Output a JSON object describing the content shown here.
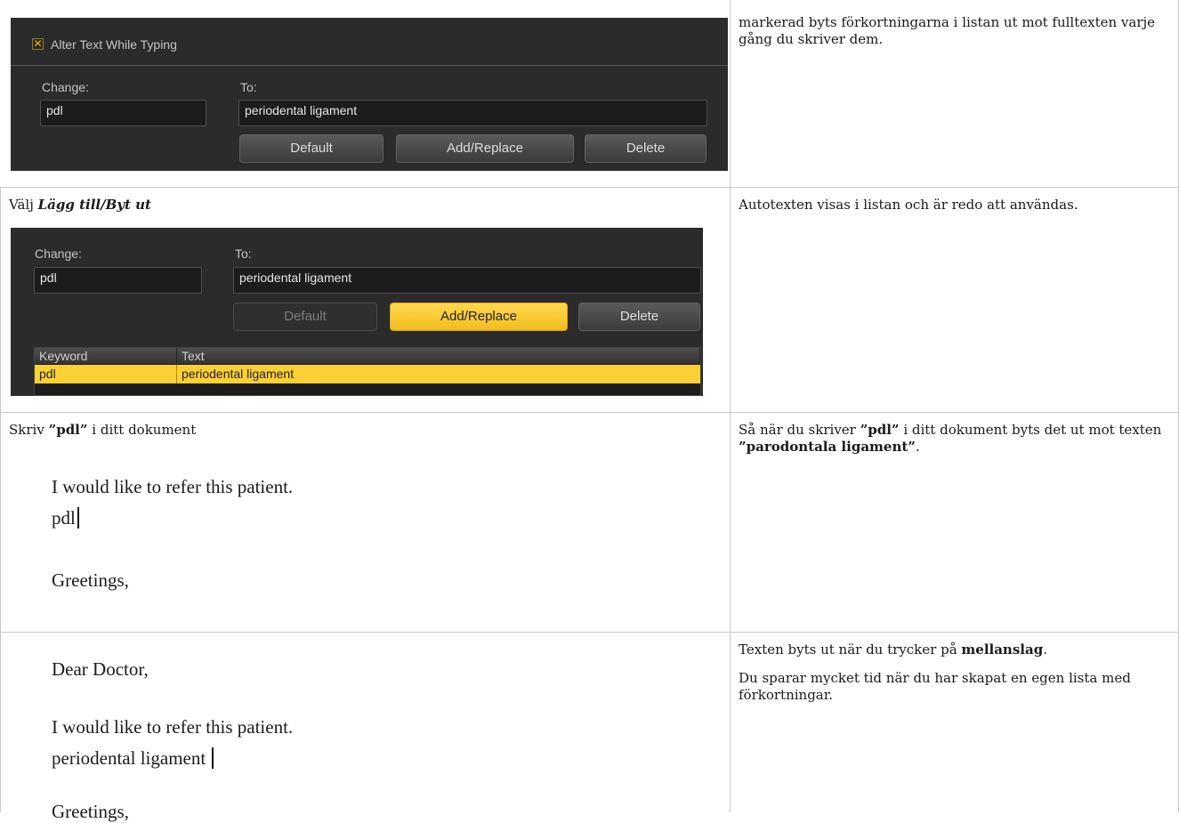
{
  "row1": {
    "panel": {
      "checkbox_label": "Alter Text While Typing",
      "change_label": "Change:",
      "to_label": "To:",
      "change_value": "pdl",
      "to_value": "periodental ligament",
      "buttons": [
        "Default",
        "Add/Replace",
        "Delete"
      ]
    },
    "right_text": "markerad byts förkortningarna i listan ut mot fulltexten varje gång du skriver dem."
  },
  "row2": {
    "left_prefix": "Välj ",
    "left_emph": "Lägg till/Byt ut",
    "panel": {
      "change_label": "Change:",
      "to_label": "To:",
      "change_value": "pdl",
      "to_value": "periodental ligament",
      "buttons": [
        "Default",
        "Add/Replace",
        "Delete"
      ],
      "list_headers": [
        "Keyword",
        "Text"
      ],
      "list_row": [
        "pdl",
        "periodental ligament"
      ]
    },
    "right_text": "Autotexten visas i listan och är redo att användas."
  },
  "row3": {
    "left_prefix": "Skriv ",
    "left_bold": "”pdl”",
    "left_suffix": " i ditt dokument",
    "doc_lines": [
      "I would like to refer this patient.",
      "pdl",
      "Greetings,"
    ],
    "right_p1": "Så när du skriver ",
    "right_b1": "”pdl”",
    "right_p2": " i ditt dokument byts det ut mot texten ",
    "right_b2": "”parodontala ligament”",
    "right_p3": "."
  },
  "row4": {
    "doc_lines": [
      "Dear Doctor,",
      "I would like to refer this patient.",
      "periodental ligament",
      "Greetings,"
    ],
    "right_p1a": "Texten byts ut när du trycker på ",
    "right_p1b": "mellanslag",
    "right_p1c": ".",
    "right_p2": "Du sparar mycket tid när du har skapat en egen lista med förkortningar."
  },
  "colors": {
    "accent": "#fbd034",
    "panel": "#2b2b2b",
    "rule": "#c8c8c8"
  }
}
